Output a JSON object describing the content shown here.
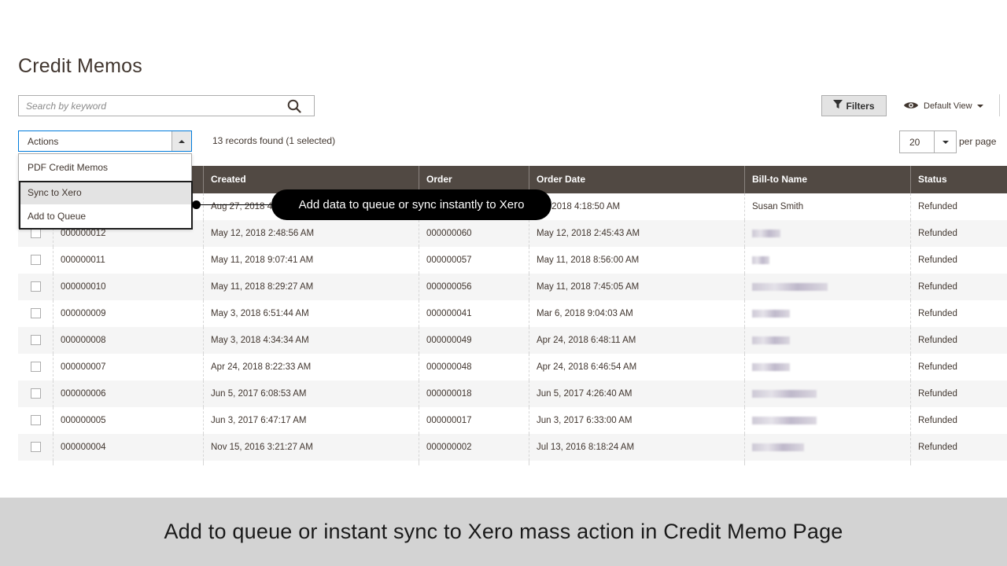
{
  "page": {
    "title": "Credit Memos"
  },
  "search": {
    "placeholder": "Search by keyword"
  },
  "toolbar": {
    "filters_label": "Filters",
    "view_label": "Default View",
    "actions_label": "Actions",
    "records_text": "13 records found (1 selected)",
    "per_page_value": "20",
    "per_page_label": "per page"
  },
  "actions_menu": {
    "options": [
      "PDF Credit Memos",
      "Sync to Xero",
      "Add to Queue"
    ]
  },
  "grid": {
    "columns": [
      "",
      "Created",
      "Order",
      "Order Date",
      "Bill-to Name",
      "Status"
    ],
    "rows": [
      {
        "id": "",
        "created": "Aug 27, 2018 4:",
        "order": "",
        "order_date": "25, 2018 4:18:50 AM",
        "bill_to": "Susan Smith",
        "status": "Refunded"
      },
      {
        "id": "000000012",
        "created": "May 12, 2018 2:48:56 AM",
        "order": "000000060",
        "order_date": "May 12, 2018 2:45:43 AM",
        "bill_to": "",
        "status": "Refunded"
      },
      {
        "id": "000000011",
        "created": "May 11, 2018 9:07:41 AM",
        "order": "000000057",
        "order_date": "May 11, 2018 8:56:00 AM",
        "bill_to": "",
        "status": "Refunded"
      },
      {
        "id": "000000010",
        "created": "May 11, 2018 8:29:27 AM",
        "order": "000000056",
        "order_date": "May 11, 2018 7:45:05 AM",
        "bill_to": "",
        "status": "Refunded"
      },
      {
        "id": "000000009",
        "created": "May 3, 2018 6:51:44 AM",
        "order": "000000041",
        "order_date": "Mar 6, 2018 9:04:03 AM",
        "bill_to": "",
        "status": "Refunded"
      },
      {
        "id": "000000008",
        "created": "May 3, 2018 4:34:34 AM",
        "order": "000000049",
        "order_date": "Apr 24, 2018 6:48:11 AM",
        "bill_to": "",
        "status": "Refunded"
      },
      {
        "id": "000000007",
        "created": "Apr 24, 2018 8:22:33 AM",
        "order": "000000048",
        "order_date": "Apr 24, 2018 6:46:54 AM",
        "bill_to": "",
        "status": "Refunded"
      },
      {
        "id": "000000006",
        "created": "Jun 5, 2017 6:08:53 AM",
        "order": "000000018",
        "order_date": "Jun 5, 2017 4:26:40 AM",
        "bill_to": "",
        "status": "Refunded"
      },
      {
        "id": "000000005",
        "created": "Jun 3, 2017 6:47:17 AM",
        "order": "000000017",
        "order_date": "Jun 3, 2017 6:33:00 AM",
        "bill_to": "",
        "status": "Refunded"
      },
      {
        "id": "000000004",
        "created": "Nov 15, 2016 3:21:27 AM",
        "order": "000000002",
        "order_date": "Jul 13, 2016 8:18:24 AM",
        "bill_to": "",
        "status": "Refunded"
      }
    ]
  },
  "callout": {
    "text": "Add data to queue or sync instantly to Xero"
  },
  "caption": {
    "text": "Add to queue or instant sync to Xero mass action in Credit Memo Page"
  },
  "colors": {
    "header_bg": "#514943",
    "accent_border": "#007bdb",
    "caption_bg": "#d3d3d3",
    "callout_bg": "#000000"
  }
}
